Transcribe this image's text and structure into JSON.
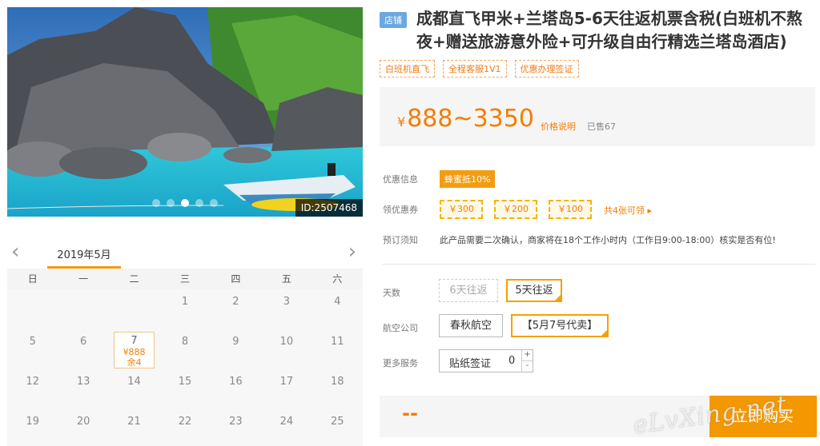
{
  "gallery": {
    "photo_id": "ID:2507468",
    "slide_count": 5,
    "active_slide": 3
  },
  "calendar": {
    "month": "2019年5月",
    "prev_icon": "chevron-left-icon",
    "next_icon": "chevron-right-icon",
    "weekdays": [
      "日",
      "一",
      "二",
      "三",
      "四",
      "五",
      "六"
    ],
    "weeks": [
      [
        {
          "d": ""
        },
        {
          "d": ""
        },
        {
          "d": ""
        },
        {
          "d": "1"
        },
        {
          "d": "2"
        },
        {
          "d": "3"
        },
        {
          "d": "4"
        }
      ],
      [
        {
          "d": "5"
        },
        {
          "d": "6"
        },
        {
          "d": "7",
          "price": "¥888",
          "stock": "余4"
        },
        {
          "d": "8"
        },
        {
          "d": "9"
        },
        {
          "d": "10"
        },
        {
          "d": "11"
        }
      ],
      [
        {
          "d": "12"
        },
        {
          "d": "13"
        },
        {
          "d": "14"
        },
        {
          "d": "15"
        },
        {
          "d": "16"
        },
        {
          "d": "17"
        },
        {
          "d": "18"
        }
      ],
      [
        {
          "d": "19"
        },
        {
          "d": "20"
        },
        {
          "d": "21"
        },
        {
          "d": "22"
        },
        {
          "d": "23"
        },
        {
          "d": "24"
        },
        {
          "d": "25"
        }
      ]
    ]
  },
  "product": {
    "shop_badge": "店铺",
    "title": "成都直飞甲米+兰塔岛5-6天往返机票含税(白班机不熬夜+赠送旅游意外险+可升级自由行精选兰塔岛酒店)",
    "tags": [
      "白班机直飞",
      "全程客服1V1",
      "优惠办理签证"
    ],
    "price_currency": "¥",
    "price_range": "888~3350",
    "price_note": "价格说明",
    "sold": "已售67"
  },
  "promo": {
    "discount_label": "优惠信息",
    "discount_badge": "蜂蜜抵10%",
    "coupon_label": "领优惠券",
    "coupons": [
      "￥300",
      "￥200",
      "￥100"
    ],
    "coupon_all": "共4张可领 ▸",
    "notice_label": "预订须知",
    "notice_text": "此产品需要二次确认，商家将在18个工作小时内（工作日9:00-18:00）核实是否有位!"
  },
  "options": {
    "days_label": "天数",
    "days": [
      {
        "label": "6天往返",
        "state": "disabled"
      },
      {
        "label": "5天往返",
        "state": "selected"
      }
    ],
    "airline_label": "航空公司",
    "airlines": [
      {
        "label": "春秋航空",
        "state": "normal"
      },
      {
        "label": "【5月7号代卖】",
        "state": "selected"
      }
    ],
    "extra_label": "更多服务",
    "extra_item": "贴纸签证",
    "extra_qty": "0",
    "plus": "+",
    "minus": "-"
  },
  "purchase": {
    "total": "--",
    "buy_label": "立即购买"
  },
  "watermark": "eLvXing.net",
  "colors": {
    "accent": "#f39800",
    "price": "#f57c00",
    "shop_badge": "#69a8e0"
  }
}
